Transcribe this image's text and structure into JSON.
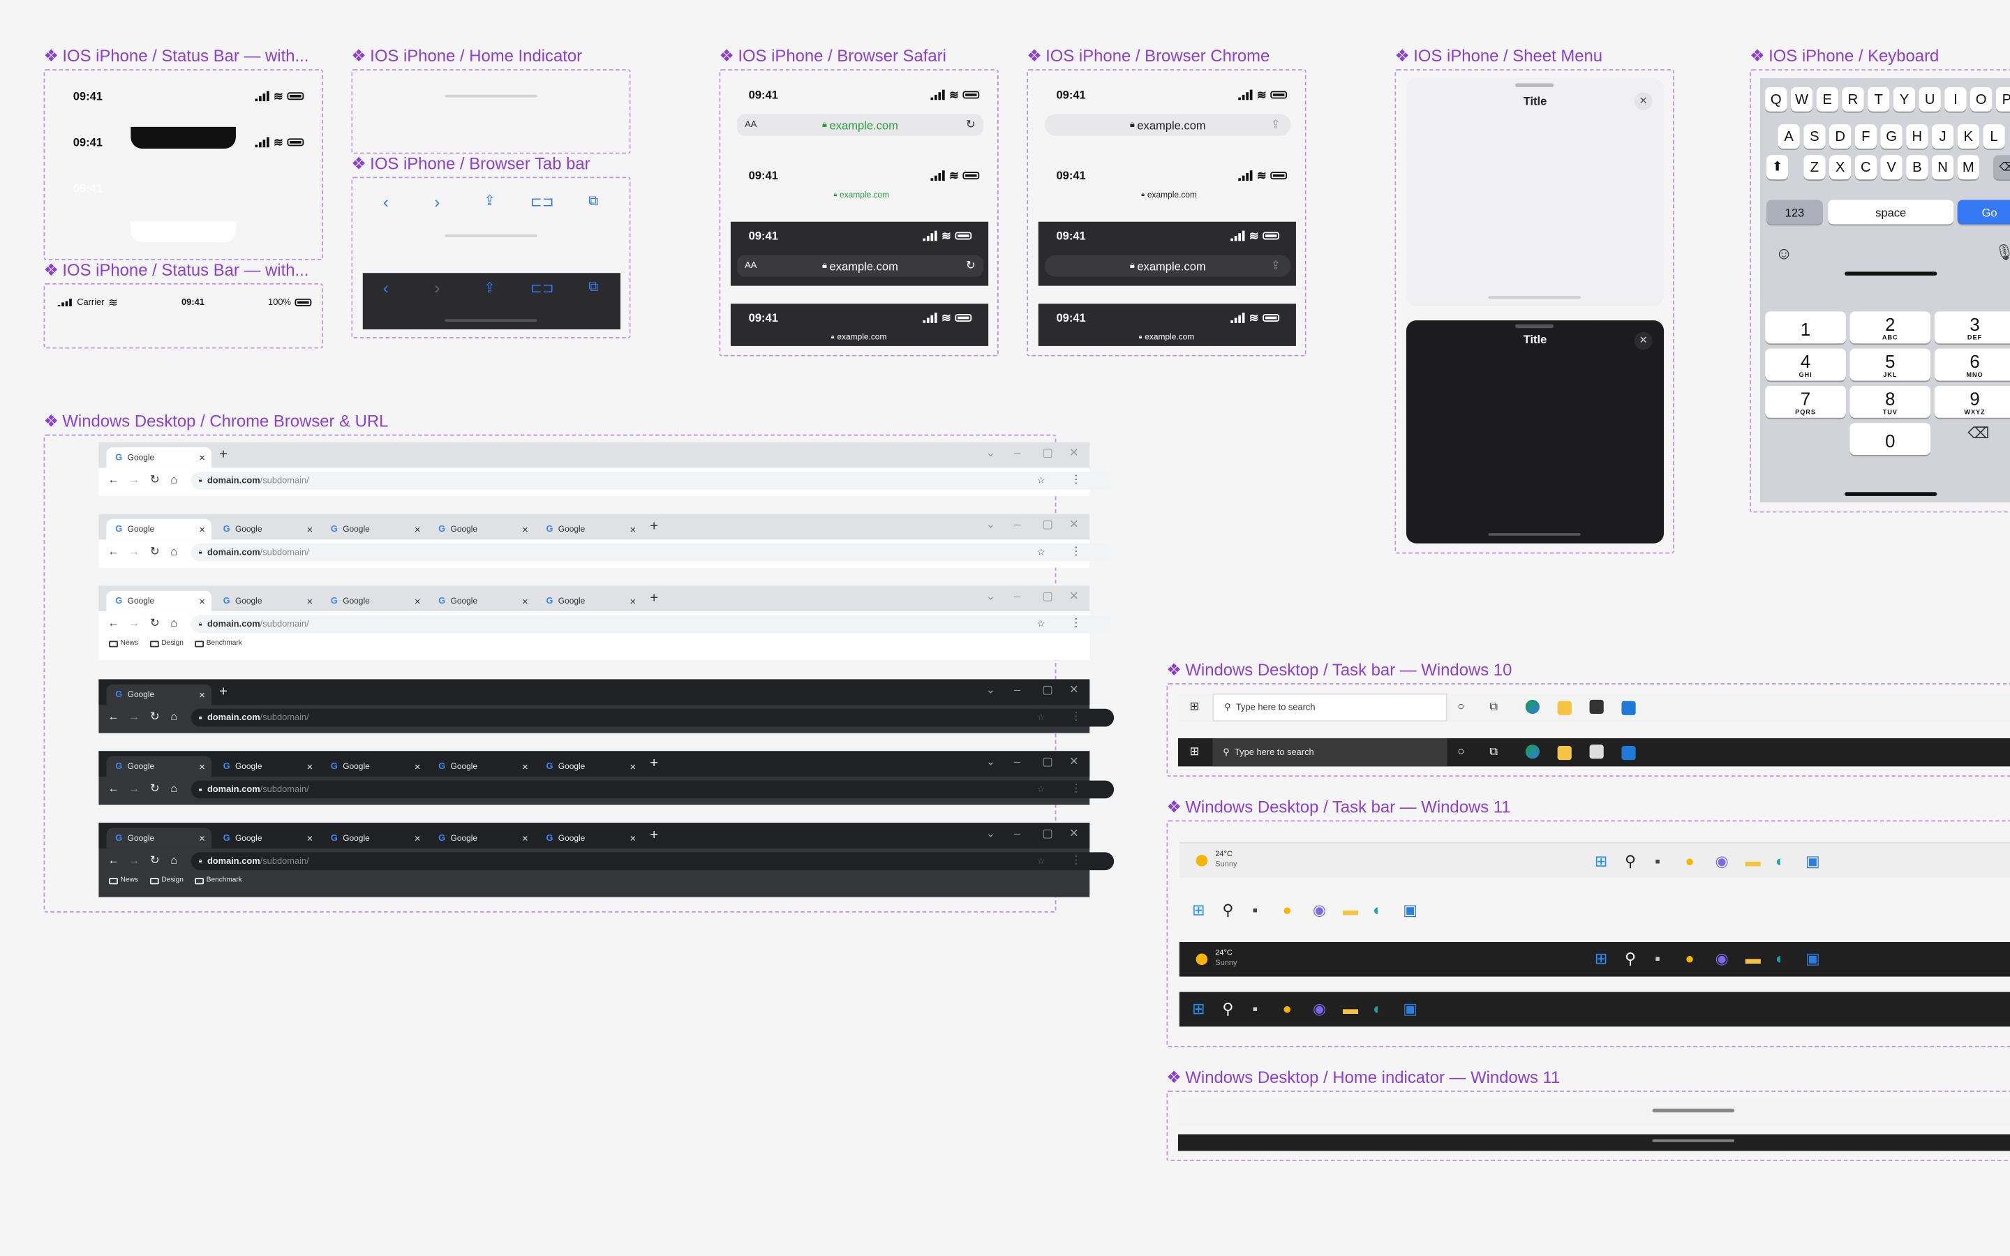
{
  "titles": {
    "status_bar_1": "IOS iPhone / Status Bar — with...",
    "home_indicator": "IOS iPhone / Home Indicator",
    "browser_safari": "IOS iPhone / Browser Safari",
    "browser_chrome": "IOS iPhone / Browser Chrome",
    "sheet_menu": "IOS iPhone / Sheet Menu",
    "keyboard": "IOS iPhone / Keyboard",
    "browser_tab_bar": "IOS iPhone / Browser Tab bar",
    "status_bar_2": "IOS iPhone / Status Bar — with...",
    "win_chrome": "Windows Desktop / Chrome Browser & URL",
    "taskbar_10": "Windows Desktop / Task bar — Windows 10",
    "taskbar_11": "Windows Desktop / Task bar — Windows 11",
    "home_indicator_11": "Windows Desktop / Home indicator — Windows 11"
  },
  "diamond": "❖",
  "status": {
    "time": "09:41",
    "carrier": "Carrier",
    "battery_pct": "100%"
  },
  "browser": {
    "text_size": "AA",
    "url": "example.com"
  },
  "sheet": {
    "title": "Title",
    "close": "✕"
  },
  "keyboard": {
    "row1": [
      "Q",
      "W",
      "E",
      "R",
      "T",
      "Y",
      "U",
      "I",
      "O",
      "P"
    ],
    "row2": [
      "A",
      "S",
      "D",
      "F",
      "G",
      "H",
      "J",
      "K",
      "L"
    ],
    "row3": [
      "Z",
      "X",
      "C",
      "V",
      "B",
      "N",
      "M"
    ],
    "numbers_key": "123",
    "space_key": "space",
    "go_key": "Go",
    "numpad": [
      {
        "n": "1",
        "s": ""
      },
      {
        "n": "2",
        "s": "ABC"
      },
      {
        "n": "3",
        "s": "DEF"
      },
      {
        "n": "4",
        "s": "GHI"
      },
      {
        "n": "5",
        "s": "JKL"
      },
      {
        "n": "6",
        "s": "MNO"
      },
      {
        "n": "7",
        "s": "PQRS"
      },
      {
        "n": "8",
        "s": "TUV"
      },
      {
        "n": "9",
        "s": "WXYZ"
      },
      {
        "n": "0",
        "s": ""
      }
    ]
  },
  "chrome": {
    "tab_label": "Google",
    "url_domain": "domain.com",
    "url_path": "/subdomain/",
    "bookmarks": [
      "News",
      "Design",
      "Benchmark"
    ],
    "light_bg": "#dfe1e5",
    "dark_bg": "#202124"
  },
  "taskbar10": {
    "search_placeholder": "Type here to search"
  },
  "taskbar11": {
    "temp": "24°C",
    "condition": "Sunny"
  },
  "colors": {
    "accent_purple": "#8a3fd6",
    "ios_blue": "#3478f6",
    "dark_ui": "#2b2b2d"
  }
}
